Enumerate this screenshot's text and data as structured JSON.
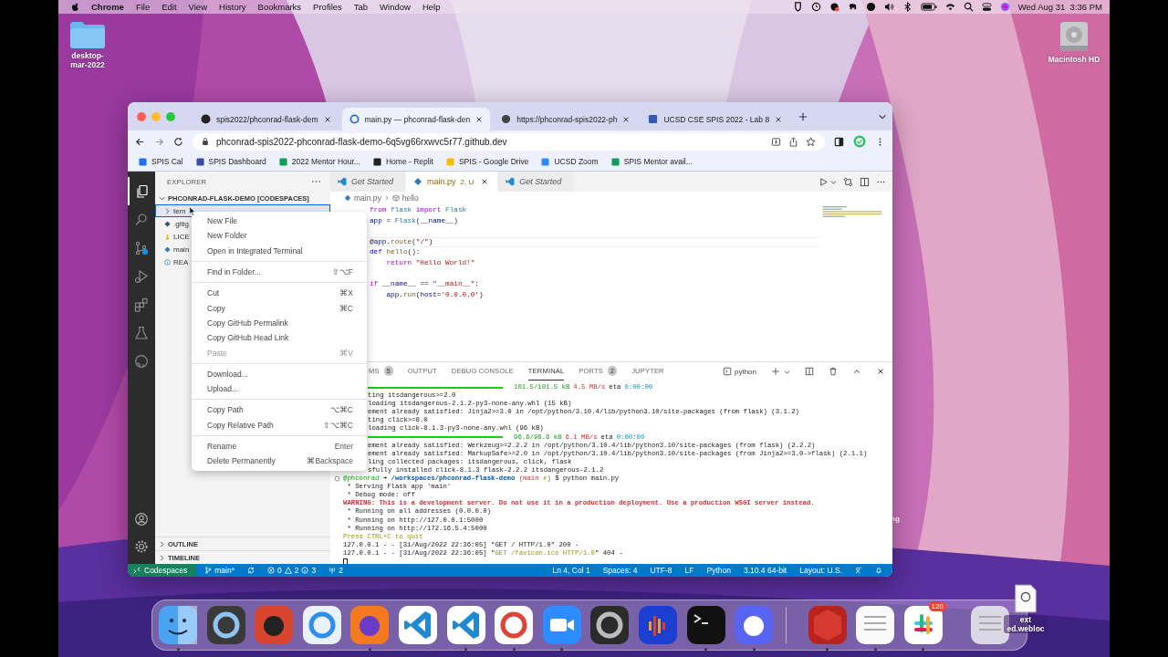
{
  "menubar": {
    "app": "Chrome",
    "menus": [
      "File",
      "Edit",
      "View",
      "History",
      "Bookmarks",
      "Profiles",
      "Tab",
      "Window",
      "Help"
    ],
    "clock": "Wed Aug 31  3:36 PM"
  },
  "desktop": {
    "folder": "desktop-mar-2022",
    "disk": "Macintosh HD",
    "hidden_label": "ng",
    "file": "ext ed.webloc"
  },
  "browser": {
    "tabs": [
      {
        "title": "spis2022/phconrad-flask-dem",
        "selected": false
      },
      {
        "title": "main.py — phconrad-flask-den",
        "selected": true
      },
      {
        "title": "https://phconrad-spis2022-ph",
        "selected": false
      },
      {
        "title": "UCSD CSE SPIS 2022 - Lab 8",
        "selected": false
      }
    ],
    "url": "phconrad-spis2022-phconrad-flask-demo-6q5vg66rxwvc5r77.github.dev",
    "bookmarks": [
      "SPIS Cal",
      "SPIS Dashboard",
      "2022 Mentor Hour...",
      "Home - Replit",
      "SPIS - Google Drive",
      "UCSD Zoom",
      "SPIS Mentor avail..."
    ]
  },
  "vscode": {
    "activity": [
      {
        "selected": true
      },
      {
        "selected": false
      },
      {
        "selected": false
      },
      {
        "selected": false
      },
      {
        "selected": false
      },
      {
        "selected": false
      },
      {
        "selected": false
      }
    ],
    "explorer": {
      "title": "EXPLORER",
      "root": "PHCONRAD-FLASK-DEMO [CODESPACES]",
      "items": [
        {
          "name": "tem",
          "kind": "folder",
          "selected": true
        },
        {
          "name": ".gitig",
          "kind": "git",
          "selected": false
        },
        {
          "name": "LICE",
          "kind": "license",
          "selected": false
        },
        {
          "name": "main",
          "kind": "python",
          "selected": false
        },
        {
          "name": "REA",
          "kind": "info",
          "selected": false
        }
      ],
      "sections": [
        "OUTLINE",
        "TIMELINE"
      ]
    },
    "context_menu": {
      "groups": [
        [
          {
            "label": "New File",
            "disabled": false
          },
          {
            "label": "New Folder",
            "disabled": false
          },
          {
            "label": "Open in Integrated Terminal",
            "disabled": false
          }
        ],
        [
          {
            "label": "Find in Folder...",
            "shortcut": "⇧⌥F",
            "disabled": false
          }
        ],
        [
          {
            "label": "Cut",
            "shortcut": "⌘X",
            "disabled": false
          },
          {
            "label": "Copy",
            "shortcut": "⌘C",
            "disabled": false
          },
          {
            "label": "Copy GitHub Permalink",
            "disabled": false
          },
          {
            "label": "Copy GitHub Head Link",
            "disabled": false
          },
          {
            "label": "Paste",
            "shortcut": "⌘V",
            "disabled": true
          }
        ],
        [
          {
            "label": "Download...",
            "disabled": false
          },
          {
            "label": "Upload...",
            "disabled": false
          }
        ],
        [
          {
            "label": "Copy Path",
            "shortcut": "⌥⌘C",
            "disabled": false
          },
          {
            "label": "Copy Relative Path",
            "shortcut": "⇧⌥⌘C",
            "disabled": false
          }
        ],
        [
          {
            "label": "Rename",
            "shortcut": "Enter",
            "disabled": false
          },
          {
            "label": "Delete Permanently",
            "shortcut": "⌘Backspace",
            "disabled": false
          }
        ]
      ]
    },
    "editor": {
      "tabs": [
        {
          "title": "Get Started",
          "selected": false
        },
        {
          "title": "main.py",
          "status": "2, U",
          "selected": true
        },
        {
          "title": "Get Started",
          "selected": false
        }
      ],
      "breadcrumb": [
        "main.py",
        "hello"
      ],
      "lines": [
        {
          "current": false,
          "tokens": [
            {
              "t": "from",
              "kind": "keyword"
            },
            {
              "t": " flask ",
              "kind": "type"
            },
            {
              "t": "import",
              "kind": "keyword"
            },
            {
              "t": " Flask",
              "kind": "type"
            }
          ]
        },
        {
          "current": false,
          "tokens": [
            {
              "t": "app",
              "kind": "variable"
            },
            {
              "t": " = ",
              "kind": "plain"
            },
            {
              "t": "Flask",
              "kind": "type"
            },
            {
              "t": "(",
              "kind": "plain"
            },
            {
              "t": "__name__",
              "kind": "variable"
            },
            {
              "t": ")",
              "kind": "plain"
            }
          ]
        },
        {
          "current": false
        },
        {
          "current": true,
          "tokens": [
            {
              "t": "@",
              "kind": "plain"
            },
            {
              "t": "app",
              "kind": "variable"
            },
            {
              "t": ".",
              "kind": "plain"
            },
            {
              "t": "route",
              "kind": "function"
            },
            {
              "t": "(",
              "kind": "plain"
            },
            {
              "t": "\"/\"",
              "kind": "string"
            },
            {
              "t": ")",
              "kind": "plain"
            }
          ]
        },
        {
          "current": false,
          "tokens": [
            {
              "t": "def",
              "kind": "storage"
            },
            {
              "t": " hello",
              "kind": "function"
            },
            {
              "t": "():",
              "kind": "plain"
            }
          ]
        },
        {
          "current": false,
          "tokens": [
            {
              "t": "    return",
              "kind": "keyword"
            },
            {
              "t": " \"Hello World!\"",
              "kind": "string"
            }
          ]
        },
        {
          "current": false
        },
        {
          "current": false,
          "tokens": [
            {
              "t": "if",
              "kind": "keyword"
            },
            {
              "t": " __name__",
              "kind": "variable"
            },
            {
              "t": " == ",
              "kind": "plain"
            },
            {
              "t": "\"__main__\"",
              "kind": "string"
            },
            {
              "t": ":",
              "kind": "plain"
            }
          ]
        },
        {
          "current": false,
          "tokens": [
            {
              "t": "    app",
              "kind": "variable"
            },
            {
              "t": ".",
              "kind": "plain"
            },
            {
              "t": "run",
              "kind": "function"
            },
            {
              "t": "(",
              "kind": "plain"
            },
            {
              "t": "host",
              "kind": "variable"
            },
            {
              "t": "=",
              "kind": "plain"
            },
            {
              "t": "'0.0.0.0'",
              "kind": "string"
            },
            {
              "t": ")",
              "kind": "plain"
            }
          ]
        }
      ]
    },
    "panel": {
      "tabs": [
        {
          "label": "MS",
          "badge": "5",
          "selected": false
        },
        {
          "label": "OUTPUT",
          "selected": false
        },
        {
          "label": "DEBUG CONSOLE",
          "selected": false
        },
        {
          "label": "TERMINAL",
          "selected": true
        },
        {
          "label": "PORTS",
          "badge": "2",
          "selected": false
        },
        {
          "label": "JUPYTER",
          "selected": false
        }
      ],
      "terminal_name": "python",
      "lines": [
        {
          "kind": "progress",
          "level": 1,
          "size": "101.5/101.5 kB",
          "rate": "4.5 MB/s",
          "eta": "eta",
          "time": "0:00:00"
        },
        {
          "kind": "partial",
          "text": "ting itsdangerous>=2.0"
        },
        {
          "kind": "partial",
          "text": "loading itsdangerous-2.1.2-py3-none-any.whl (15 kB)"
        },
        {
          "kind": "partial",
          "text": "ement already satisfied: Jinja2>=3.0 in /opt/python/3.10.4/lib/python3.10/site-packages (from flask) (3.1.2)"
        },
        {
          "kind": "partial",
          "text": "ting click>=8.0"
        },
        {
          "kind": "partial",
          "text": "loading click-8.1.3-py3-none-any.whl (96 kB)"
        },
        {
          "kind": "progress",
          "level": 1,
          "size": "96.6/96.6 kB",
          "rate": "6.1 MB/s",
          "eta": "eta",
          "time": "0:00:00"
        },
        {
          "kind": "partial",
          "text": "ement already satisfied: Werkzeug>=2.2.2 in /opt/python/3.10.4/lib/python3.10/site-packages (from flask) (2.2.2)"
        },
        {
          "kind": "partial",
          "text": "ement already satisfied: MarkupSafe>=2.0 in /opt/python/3.10.4/lib/python3.10/site-packages (from Jinja2>=3.0->flask) (2.1.1)"
        },
        {
          "kind": "partial",
          "text": "ling collected packages: itsdangerous, click, flask"
        },
        {
          "kind": "partial",
          "text": "sfully installed click-8.1.3 flask-2.2.2 itsdangerous-2.1.2"
        },
        {
          "kind": "prompt",
          "parts": [
            {
              "t": "@phconrad",
              "kind": "user"
            },
            {
              "t": " ➜ ",
              "kind": "plain"
            },
            {
              "t": "/workspaces/phconrad-flask-demo",
              "kind": "path"
            },
            {
              "t": " (main ",
              "kind": "branch"
            },
            {
              "t": "✗",
              "kind": "dirty"
            },
            {
              "t": ")",
              "kind": "branch"
            },
            {
              "t": " $ python main.py",
              "kind": "plain"
            }
          ]
        },
        {
          "kind": "out",
          "text": " * Serving Flask app 'main'"
        },
        {
          "kind": "out",
          "text": " * Debug mode: off"
        },
        {
          "kind": "warning",
          "text": "WARNING: This is a development server. Do not use it in a production deployment. Use a production WSGI server instead."
        },
        {
          "kind": "out",
          "text": " * Running on all addresses (0.0.0.0)"
        },
        {
          "kind": "out",
          "text": " * Running on http://127.0.0.1:5000"
        },
        {
          "kind": "out",
          "text": " * Running on http://172.16.5.4:5000"
        },
        {
          "kind": "hint",
          "text": "Press CTRL+C to quit"
        },
        {
          "kind": "log",
          "parts": [
            {
              "t": "127.0.0.1 - - [31/Aug/2022 22:36:05] \"",
              "kind": "plain"
            },
            {
              "t": "GET / HTTP/1.0",
              "kind": "plain"
            },
            {
              "t": "\" 200 -",
              "kind": "plain"
            }
          ]
        },
        {
          "kind": "log",
          "parts": [
            {
              "t": "127.0.0.1 - - [31/Aug/2022 22:36:05] \"",
              "kind": "plain"
            },
            {
              "t": "GET /favicon.ico HTTP/1.0",
              "kind": "request"
            },
            {
              "t": "\" 404 -",
              "kind": "plain"
            }
          ]
        },
        {
          "kind": "cursor"
        }
      ]
    },
    "statusbar": {
      "remote": "Codespaces",
      "branch": "main*",
      "errors": "0",
      "warnings": "2",
      "infos": "3",
      "ports": "2",
      "right": [
        "Ln 4, Col 1",
        "Spaces: 4",
        "UTF-8",
        "LF",
        "Python",
        "3.10.4 64-bit",
        "Layout: U.S."
      ]
    }
  },
  "dock": {
    "apps": [
      {
        "running": true
      },
      {
        "running": false
      },
      {
        "running": false
      },
      {
        "running": false
      },
      {
        "running": true
      },
      {
        "running": false
      },
      {
        "running": true
      },
      {
        "running": true
      },
      {
        "running": true
      },
      {
        "running": false
      },
      {
        "running": false
      },
      {
        "running": true
      },
      {
        "running": true
      },
      {
        "running": true
      },
      {
        "running": true
      },
      {
        "running": true
      },
      {
        "running": false
      }
    ],
    "badge": "120"
  }
}
